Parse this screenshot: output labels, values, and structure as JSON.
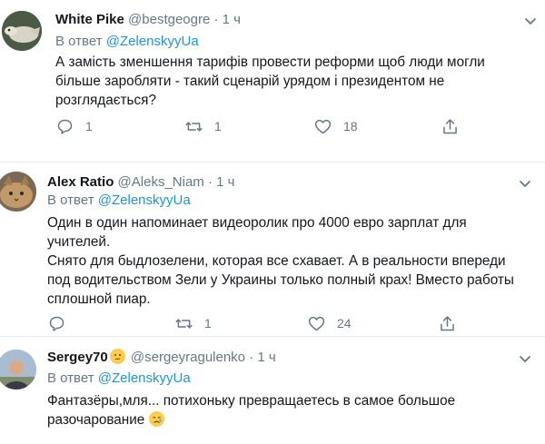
{
  "reply_prefix": "В ответ",
  "tweets": [
    {
      "name": "White Pike",
      "handle": "@bestgeogre",
      "dot": "·",
      "time": "1 ч",
      "reply_to": "@ZelenskyyUa",
      "lines": [
        "А замість зменшення тарифів провести реформи щоб люди могли",
        "більше заробляти - такий сценарій урядом і президентом не",
        "розглядається?"
      ],
      "replies": "1",
      "retweets": "1",
      "likes": "18"
    },
    {
      "name": "Alex Ratio",
      "handle": "@Aleks_Niam",
      "dot": "·",
      "time": "1 ч",
      "reply_to": "@ZelenskyyUa",
      "lines": [
        "Один в один напоминает видеоролик про 4000 евро зарплат для",
        "учителей.",
        "Снято для быдлозелени, которая все схавает. А в реальности впереди",
        "под водительством Зели у Украины только полный крах! Вместо работы",
        "сплошной пиар."
      ],
      "replies": "",
      "retweets": "1",
      "likes": "24"
    },
    {
      "name": "Sergey70",
      "handle": "@sergeyragulenko",
      "dot": "·",
      "time": "1 ч",
      "reply_to": "@ZelenskyyUa",
      "lines": [
        "Фантазёры,мля... потихоньку превращаетесь в самое большое",
        "разочарование"
      ]
    }
  ],
  "colors": {
    "accent": "#1b95e0",
    "muted": "#657786",
    "text": "#14171a",
    "divider": "#e6ecf0"
  }
}
